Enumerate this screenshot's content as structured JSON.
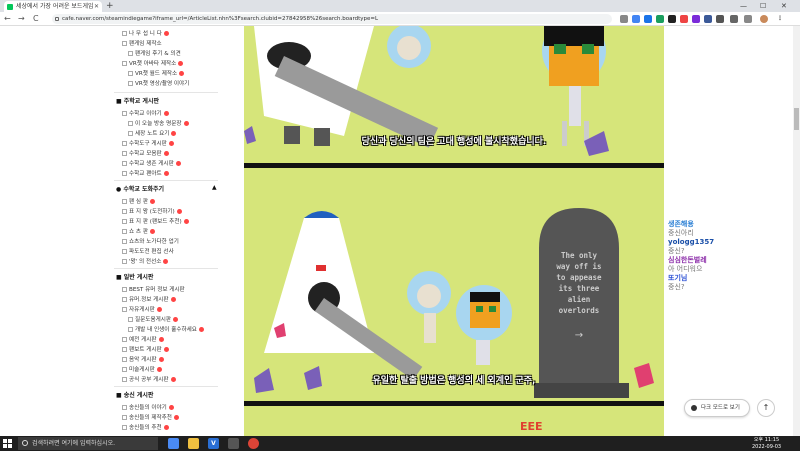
{
  "browser": {
    "tab_title": "세상에서 가장 어려운 보드게임",
    "new_tab": "+",
    "url": "cafe.naver.com/steamindiegame?iframe_url=/ArticleList.nhn%3Fsearch.clubid=27842958%26search.boardtype=L",
    "win_min": "—",
    "win_max": "☐",
    "win_close": "✕",
    "back": "←",
    "forward": "→",
    "reload": "C"
  },
  "sidebar": {
    "items_top": [
      "나 무 섭 니 다",
      "팬게임 제작소",
      "팬게임 후기 & 의견",
      "VR챗 아바타 제작소",
      "VR챗 월드 제작소",
      "VR챗 영상/촬영 이야기"
    ],
    "head1": "주학교 게시판",
    "items_mid": [
      "수학교 이야기",
      "이 오늘 방송 명문장",
      "세장 노트 요기",
      "수학도구 게시판",
      "수학교 모음판",
      "수학교 생존 게시판",
      "수학교 팬아트"
    ],
    "head2": "수학교 도화주기",
    "items_mid2": [
      "팬 심 판",
      "표 지 왕 (도전하기)",
      "표 지 판 (팬보드 추천)",
      "쇼 츠 판",
      "쇼츠와 노가다한 업기",
      "파도도전 편집 선사",
      "'왕' 의 전선소"
    ],
    "head3": "일반 게시판",
    "items_bottom": [
      "BEST 유머 정보 게시판",
      "유머.정보 게시판",
      "자유게시판",
      "질문도움게시판",
      "개발 내 인생이 훌수하세요",
      "예전 게시판",
      "팬보트 게시판",
      "음악 게시판",
      "미술게시판",
      "공식 공부 게시판"
    ],
    "head4": "송신 게시판",
    "items_last": [
      "송신들의 이야기",
      "송신들의 제작추천",
      "송신들의 추천"
    ]
  },
  "content": {
    "subtitle1": "당신과 당신의 팀은 고대 행성에 불시착했습니다.",
    "subtitle2": "유일한 탈출 방법은 행성의 세 외계인 군주,",
    "tombstone_text": "The only way off is to appease its three alien overlords",
    "next_peek": "EEE"
  },
  "chat": {
    "messages": [
      {
        "name": "생존해용",
        "msg": "중신아리",
        "color": "#2a7fd4"
      },
      {
        "name": "yologg1357",
        "msg": "중신?",
        "color": "#1a4fa8"
      },
      {
        "name": "심심한돈벌레",
        "msg": "아 어디워으",
        "color": "#8a2aa8"
      },
      {
        "name": "또기님",
        "msg": "중신?",
        "color": "#2a4fd4"
      }
    ]
  },
  "floating": {
    "dark_mode": "다크 모드로 보기",
    "to_top": "↑"
  },
  "taskbar": {
    "search_placeholder": "검색하려면 여기에 입력하십시오.",
    "time": "오후 11:15",
    "date": "2022-09-03"
  },
  "colors": {
    "panel_bg": "#d6e57a",
    "naver_green": "#03c75a",
    "taskbar": "#1f1f1f"
  }
}
